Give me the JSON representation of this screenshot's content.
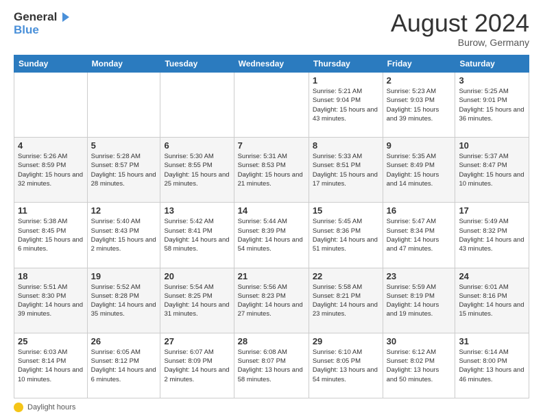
{
  "logo": {
    "line1": "General",
    "line2": "Blue"
  },
  "title": "August 2024",
  "location": "Burow, Germany",
  "days_header": [
    "Sunday",
    "Monday",
    "Tuesday",
    "Wednesday",
    "Thursday",
    "Friday",
    "Saturday"
  ],
  "weeks": [
    [
      {
        "day": "",
        "info": ""
      },
      {
        "day": "",
        "info": ""
      },
      {
        "day": "",
        "info": ""
      },
      {
        "day": "",
        "info": ""
      },
      {
        "day": "1",
        "info": "Sunrise: 5:21 AM\nSunset: 9:04 PM\nDaylight: 15 hours\nand 43 minutes."
      },
      {
        "day": "2",
        "info": "Sunrise: 5:23 AM\nSunset: 9:03 PM\nDaylight: 15 hours\nand 39 minutes."
      },
      {
        "day": "3",
        "info": "Sunrise: 5:25 AM\nSunset: 9:01 PM\nDaylight: 15 hours\nand 36 minutes."
      }
    ],
    [
      {
        "day": "4",
        "info": "Sunrise: 5:26 AM\nSunset: 8:59 PM\nDaylight: 15 hours\nand 32 minutes."
      },
      {
        "day": "5",
        "info": "Sunrise: 5:28 AM\nSunset: 8:57 PM\nDaylight: 15 hours\nand 28 minutes."
      },
      {
        "day": "6",
        "info": "Sunrise: 5:30 AM\nSunset: 8:55 PM\nDaylight: 15 hours\nand 25 minutes."
      },
      {
        "day": "7",
        "info": "Sunrise: 5:31 AM\nSunset: 8:53 PM\nDaylight: 15 hours\nand 21 minutes."
      },
      {
        "day": "8",
        "info": "Sunrise: 5:33 AM\nSunset: 8:51 PM\nDaylight: 15 hours\nand 17 minutes."
      },
      {
        "day": "9",
        "info": "Sunrise: 5:35 AM\nSunset: 8:49 PM\nDaylight: 15 hours\nand 14 minutes."
      },
      {
        "day": "10",
        "info": "Sunrise: 5:37 AM\nSunset: 8:47 PM\nDaylight: 15 hours\nand 10 minutes."
      }
    ],
    [
      {
        "day": "11",
        "info": "Sunrise: 5:38 AM\nSunset: 8:45 PM\nDaylight: 15 hours\nand 6 minutes."
      },
      {
        "day": "12",
        "info": "Sunrise: 5:40 AM\nSunset: 8:43 PM\nDaylight: 15 hours\nand 2 minutes."
      },
      {
        "day": "13",
        "info": "Sunrise: 5:42 AM\nSunset: 8:41 PM\nDaylight: 14 hours\nand 58 minutes."
      },
      {
        "day": "14",
        "info": "Sunrise: 5:44 AM\nSunset: 8:39 PM\nDaylight: 14 hours\nand 54 minutes."
      },
      {
        "day": "15",
        "info": "Sunrise: 5:45 AM\nSunset: 8:36 PM\nDaylight: 14 hours\nand 51 minutes."
      },
      {
        "day": "16",
        "info": "Sunrise: 5:47 AM\nSunset: 8:34 PM\nDaylight: 14 hours\nand 47 minutes."
      },
      {
        "day": "17",
        "info": "Sunrise: 5:49 AM\nSunset: 8:32 PM\nDaylight: 14 hours\nand 43 minutes."
      }
    ],
    [
      {
        "day": "18",
        "info": "Sunrise: 5:51 AM\nSunset: 8:30 PM\nDaylight: 14 hours\nand 39 minutes."
      },
      {
        "day": "19",
        "info": "Sunrise: 5:52 AM\nSunset: 8:28 PM\nDaylight: 14 hours\nand 35 minutes."
      },
      {
        "day": "20",
        "info": "Sunrise: 5:54 AM\nSunset: 8:25 PM\nDaylight: 14 hours\nand 31 minutes."
      },
      {
        "day": "21",
        "info": "Sunrise: 5:56 AM\nSunset: 8:23 PM\nDaylight: 14 hours\nand 27 minutes."
      },
      {
        "day": "22",
        "info": "Sunrise: 5:58 AM\nSunset: 8:21 PM\nDaylight: 14 hours\nand 23 minutes."
      },
      {
        "day": "23",
        "info": "Sunrise: 5:59 AM\nSunset: 8:19 PM\nDaylight: 14 hours\nand 19 minutes."
      },
      {
        "day": "24",
        "info": "Sunrise: 6:01 AM\nSunset: 8:16 PM\nDaylight: 14 hours\nand 15 minutes."
      }
    ],
    [
      {
        "day": "25",
        "info": "Sunrise: 6:03 AM\nSunset: 8:14 PM\nDaylight: 14 hours\nand 10 minutes."
      },
      {
        "day": "26",
        "info": "Sunrise: 6:05 AM\nSunset: 8:12 PM\nDaylight: 14 hours\nand 6 minutes."
      },
      {
        "day": "27",
        "info": "Sunrise: 6:07 AM\nSunset: 8:09 PM\nDaylight: 14 hours\nand 2 minutes."
      },
      {
        "day": "28",
        "info": "Sunrise: 6:08 AM\nSunset: 8:07 PM\nDaylight: 13 hours\nand 58 minutes."
      },
      {
        "day": "29",
        "info": "Sunrise: 6:10 AM\nSunset: 8:05 PM\nDaylight: 13 hours\nand 54 minutes."
      },
      {
        "day": "30",
        "info": "Sunrise: 6:12 AM\nSunset: 8:02 PM\nDaylight: 13 hours\nand 50 minutes."
      },
      {
        "day": "31",
        "info": "Sunrise: 6:14 AM\nSunset: 8:00 PM\nDaylight: 13 hours\nand 46 minutes."
      }
    ]
  ],
  "footer": {
    "legend": "Daylight hours"
  }
}
